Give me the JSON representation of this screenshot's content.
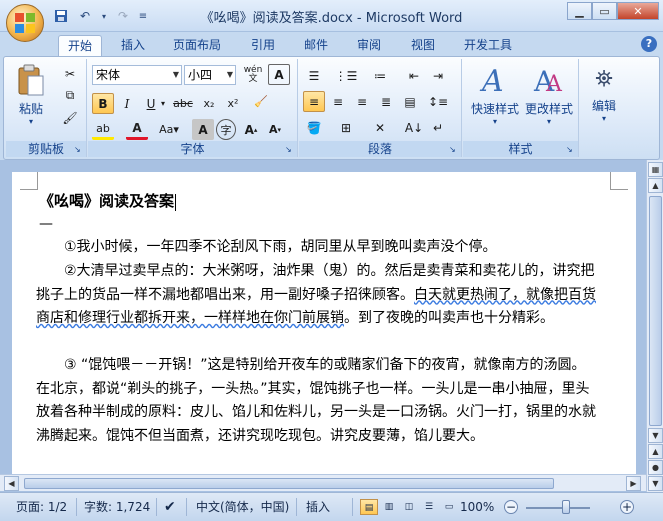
{
  "title": "《吆喝》阅读及答案.docx - Microsoft Word",
  "tabs": [
    "开始",
    "插入",
    "页面布局",
    "引用",
    "邮件",
    "审阅",
    "视图",
    "开发工具"
  ],
  "ribbon": {
    "clipboard": {
      "label": "剪贴板",
      "paste": "粘贴"
    },
    "font": {
      "label": "字体",
      "font_name": "宋体",
      "font_size": "小四",
      "wen": "wén 文"
    },
    "paragraph": {
      "label": "段落"
    },
    "styles": {
      "label": "样式",
      "quick_styles": "快速样式",
      "change_styles": "更改样式"
    },
    "editing": {
      "label": "编辑"
    }
  },
  "document": {
    "title": "《吆喝》阅读及答案",
    "dash": "—",
    "p1": "①我小时候，一年四季不论刮风下雨，胡同里从早到晚叫卖声没个停。",
    "p2a": "②大清早过卖早点的：大米粥呀，油炸果（鬼）的。然后是卖青菜和卖花儿的，讲究把挑子上的货品一样不漏地都唱出来，用一副好嗓子招徕顾客。",
    "p2u": "白天就更热闹了，就像把百货商店和修理行业都拆开来，一样样地在你门前展销",
    "p2b": "。到了夜晚的叫卖声也十分精彩。",
    "p3": "③ “馄饨喂－－开锅！”这是特别给开夜车的或赌家们备下的夜宵，就像南方的汤圆。在北京，都说“剃头的挑子，一头热。”其实，馄饨挑子也一样。一头儿是一串小抽屉，里头放着各种半制成的原料：皮儿、馅儿和佐料儿，另一头是一口汤锅。火门一打，锅里的水就沸腾起来。馄饨不但当面煮，还讲究现吃现包。讲究皮要薄，馅儿要大。"
  },
  "status": {
    "page": "页面: 1/2",
    "words": "字数: 1,724",
    "language": "中文(简体，中国)",
    "mode": "插入",
    "zoom": "100%"
  },
  "colors": {
    "accent": "#15428b",
    "highlight": "#ffc752"
  }
}
